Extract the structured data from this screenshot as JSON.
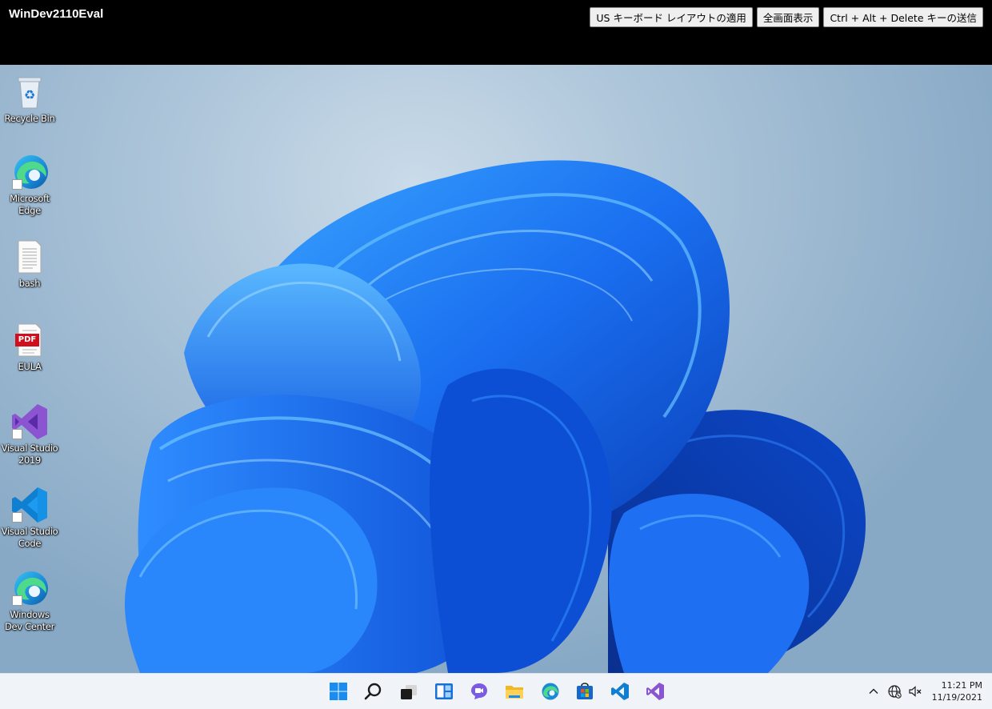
{
  "host": {
    "title": "WinDev2110Eval",
    "buttons": [
      {
        "label": "US キーボード レイアウトの適用"
      },
      {
        "label": "全画面表示"
      },
      {
        "label": "Ctrl + Alt + Delete キーの送信"
      }
    ]
  },
  "desktop": {
    "icons": [
      {
        "label": "Recycle Bin",
        "icon": "recycle-bin-icon"
      },
      {
        "label": "Microsoft Edge",
        "icon": "edge-icon"
      },
      {
        "label": "bash",
        "icon": "text-file-icon"
      },
      {
        "label": "EULA",
        "icon": "pdf-icon",
        "badge": "PDF"
      },
      {
        "label": "Visual Studio 2019",
        "icon": "visual-studio-icon"
      },
      {
        "label": "Visual Studio Code",
        "icon": "vscode-icon"
      },
      {
        "label": "Windows Dev Center",
        "icon": "edge-icon"
      }
    ]
  },
  "taskbar": {
    "apps": [
      "start-icon",
      "search-icon",
      "task-view-icon",
      "widgets-icon",
      "chat-icon",
      "file-explorer-icon",
      "edge-icon",
      "store-icon",
      "vscode-icon",
      "visual-studio-icon"
    ],
    "tray": [
      "chevron-up-icon",
      "network-icon",
      "volume-muted-icon"
    ],
    "clock": {
      "time": "11:21 PM",
      "date": "11/19/2021"
    }
  },
  "colors": {
    "accent_blue": "#1a6ff0",
    "host_bar": "#000000",
    "taskbar_bg": "#f0f3f8"
  }
}
